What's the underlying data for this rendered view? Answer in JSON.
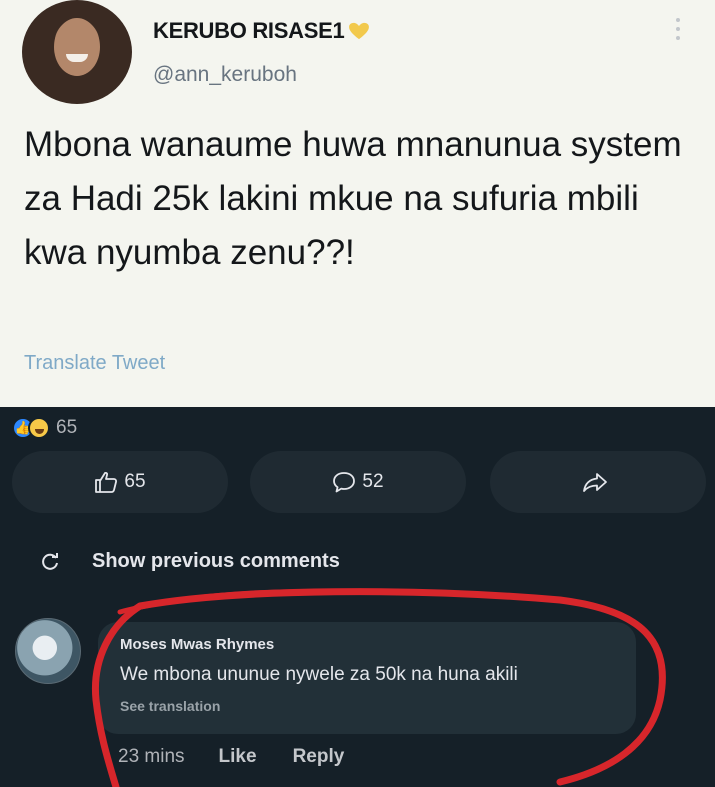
{
  "tweet": {
    "display_name": "KERUBO RISASE1",
    "handle": "@ann_keruboh",
    "text": "Mbona wanaume huwa mnanunua system za Hadi 25k lakini mkue na sufuria mbili kwa nyumba zenu??!",
    "translate_label": "Translate Tweet",
    "heart_color": "#f2c94c"
  },
  "post": {
    "reaction_count": "65",
    "actions": {
      "like_count": "65",
      "comment_count": "52"
    },
    "show_previous_label": "Show previous comments"
  },
  "comment": {
    "author": "Moses Mwas Rhymes",
    "text": "We mbona ununue nywele za 50k na huna akili",
    "see_translation": "See translation",
    "time": "23 mins",
    "like_label": "Like",
    "reply_label": "Reply"
  },
  "colors": {
    "tweet_background": "#f4f5ef",
    "dark_background": "#152028",
    "annotation": "#d7262b"
  }
}
